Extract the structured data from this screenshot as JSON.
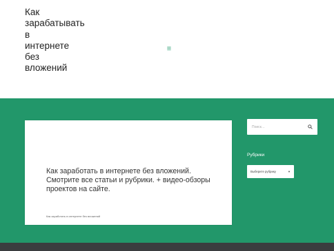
{
  "header": {
    "site_title": "Как\nзарабатывать\nв\nинтернете\nбез\nвложений",
    "menu_icon": "hamburger-menu-icon"
  },
  "main": {
    "description": "Как заработать в интернете без вложений. Смотрите все статьи и рубрики. + видео-обзоры проектов на сайте.",
    "small_caption": "Как заработать в интернете без вложений"
  },
  "sidebar": {
    "search_placeholder": "Поиск…",
    "search_icon": "magnifier-icon",
    "rubrics_title": "Рубрики",
    "select_label": "Выберите рубрику",
    "select_icon": "chevron-down-icon"
  },
  "colors": {
    "accent_green": "#22976a",
    "footer_dark": "#3a3d3f"
  }
}
